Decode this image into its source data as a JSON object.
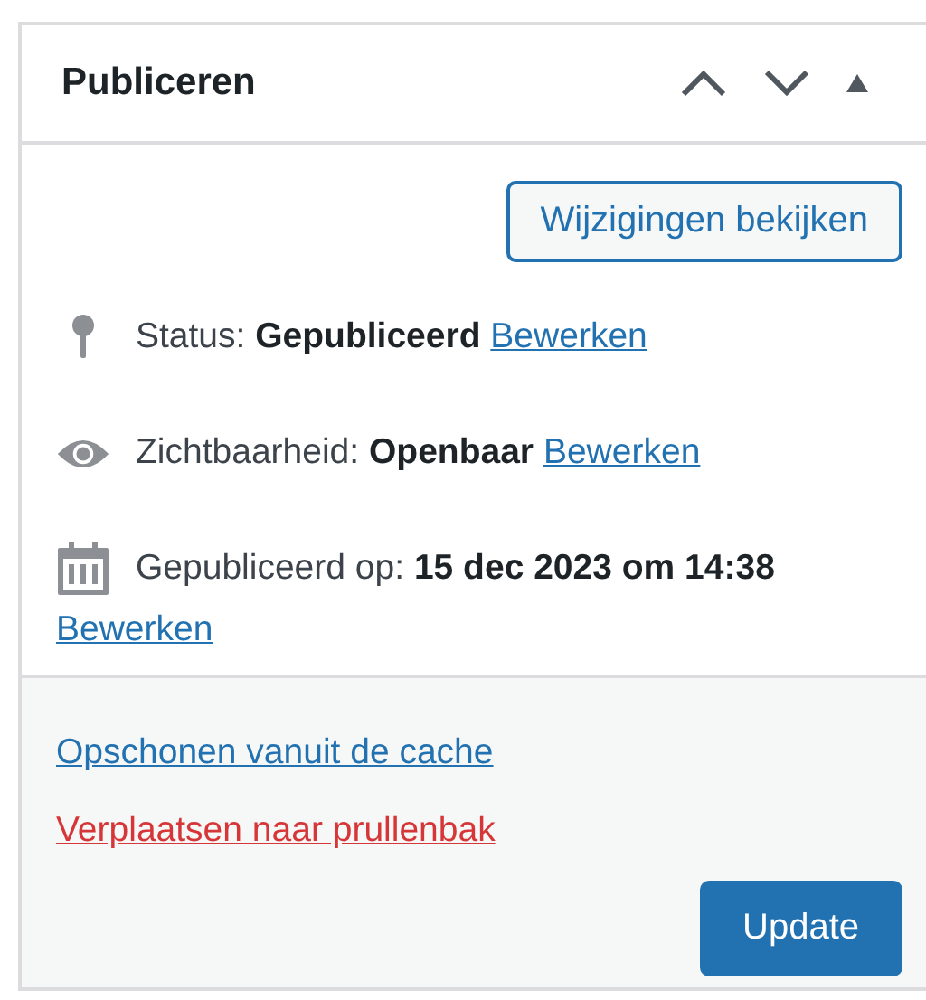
{
  "panel": {
    "title": "Publiceren",
    "controls": [
      {
        "kind": "up"
      },
      {
        "kind": "down"
      },
      {
        "kind": "toggle"
      }
    ]
  },
  "preview_button": "Wijzigingen bekijken",
  "misc": [
    {
      "kind": "status",
      "label": "Status:",
      "value": "Gepubliceerd",
      "link": "Bewerken"
    },
    {
      "kind": "visibility",
      "label": "Zichtbaarheid:",
      "value": "Openbaar",
      "link": "Bewerken"
    },
    {
      "kind": "date",
      "label": "Gepubliceerd op:",
      "value": "15 dec 2023 om 14:38",
      "link": "Bewerken"
    }
  ],
  "actions": [
    {
      "kind": "normal",
      "text": "Opschonen vanuit de cache"
    },
    {
      "kind": "delete",
      "text": "Verplaatsen naar prullenbak"
    }
  ],
  "update_button": "Update"
}
